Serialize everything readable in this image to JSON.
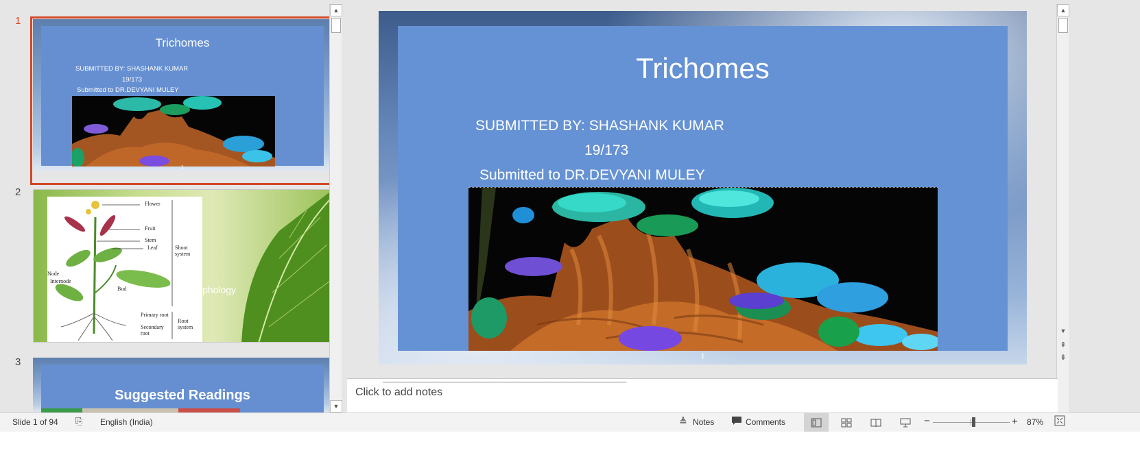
{
  "thumbnails": [
    {
      "number": "1",
      "title": "Trichomes",
      "line1": "SUBMITTED BY: SHASHANK KUMAR",
      "line2": "19/173",
      "line3": "Submitted  to DR.DEVYANI MULEY",
      "page": "1"
    },
    {
      "number": "2",
      "title_fragment": "phology",
      "diagram_labels": [
        "Flower",
        "Fruit",
        "Stem",
        "Leaf",
        "Shoot system",
        "Node",
        "Internode",
        "Bud",
        "Primary root",
        "Secondary root",
        "Root system"
      ]
    },
    {
      "number": "3",
      "title": "Suggested Readings"
    }
  ],
  "main_slide": {
    "title": "Trichomes",
    "line1": "SUBMITTED BY: SHASHANK KUMAR",
    "line2": "19/173",
    "line3": "Submitted  to DR.DEVYANI MULEY",
    "page_number": "1"
  },
  "notes": {
    "placeholder": "Click to add notes"
  },
  "status_bar": {
    "slide_indicator": "Slide 1 of 94",
    "language": "English (India)",
    "notes_label": "Notes",
    "comments_label": "Comments",
    "zoom_minus": "−",
    "zoom_plus": "+",
    "zoom_level": "87%"
  },
  "colors": {
    "accent": "#d24726",
    "slide_blue": "#6592d4"
  },
  "zoom_fraction": 0.53
}
